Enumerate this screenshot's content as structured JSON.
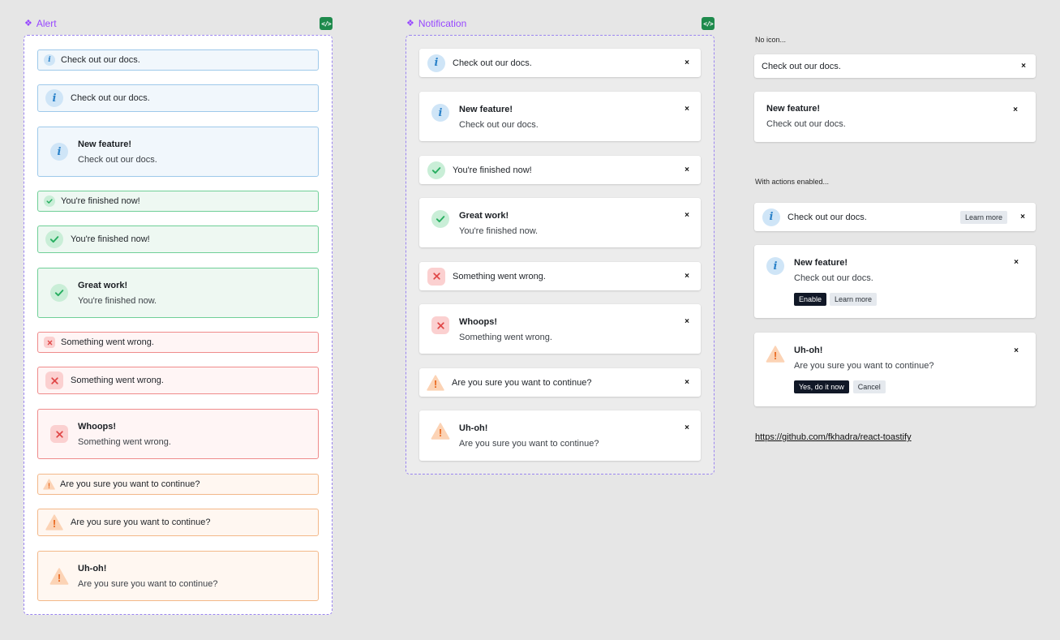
{
  "alert_frame": {
    "label": "Alert",
    "code_badge": "</>"
  },
  "notification_frame": {
    "label": "Notification",
    "code_badge": "</>"
  },
  "icons": {
    "info": "i",
    "close": "×",
    "warning": "!"
  },
  "alert": {
    "info_sm": "Check out our docs.",
    "info_md": "Check out our docs.",
    "info_lg_title": "New feature!",
    "info_lg_body": "Check out our docs.",
    "success_sm": "You're finished now!",
    "success_md": "You're finished now!",
    "success_lg_title": "Great work!",
    "success_lg_body": "You're finished now.",
    "error_sm": "Something went wrong.",
    "error_md": "Something went wrong.",
    "error_lg_title": "Whoops!",
    "error_lg_body": "Something went wrong.",
    "warn_sm": "Are you sure you want to continue?",
    "warn_md": "Are you sure you want to continue?",
    "warn_lg_title": "Uh-oh!",
    "warn_lg_body": "Are you sure you want to continue?"
  },
  "notification": {
    "info_md": "Check out our docs.",
    "info_lg_title": "New feature!",
    "info_lg_body": "Check out our docs.",
    "success_md": "You're finished now!",
    "success_lg_title": "Great work!",
    "success_lg_body": "You're finished now.",
    "error_md": "Something went wrong.",
    "error_lg_title": "Whoops!",
    "error_lg_body": "Something went wrong.",
    "warn_md": "Are you sure you want to continue?",
    "warn_lg_title": "Uh-oh!",
    "warn_lg_body": "Are you sure you want to continue?"
  },
  "no_icon": {
    "label": "No icon...",
    "single": "Check out our docs.",
    "title": "New feature!",
    "body": "Check out our docs."
  },
  "actions": {
    "label": "With actions enabled...",
    "info_text": "Check out our docs.",
    "learn_more_inline": "Learn more",
    "feature_title": "New feature!",
    "feature_body": "Check out our docs.",
    "enable": "Enable",
    "learn_more": "Learn more",
    "warn_title": "Uh-oh!",
    "warn_body": "Are you sure you want to continue?",
    "confirm": "Yes, do it now",
    "cancel": "Cancel"
  },
  "repo_link": "https://github.com/fkhadra/react-toastify",
  "colors": {
    "info": "#2b82c9",
    "success": "#27ae60",
    "error": "#e04848",
    "warning": "#e9671d",
    "frame_dash": "#9b85f0"
  }
}
